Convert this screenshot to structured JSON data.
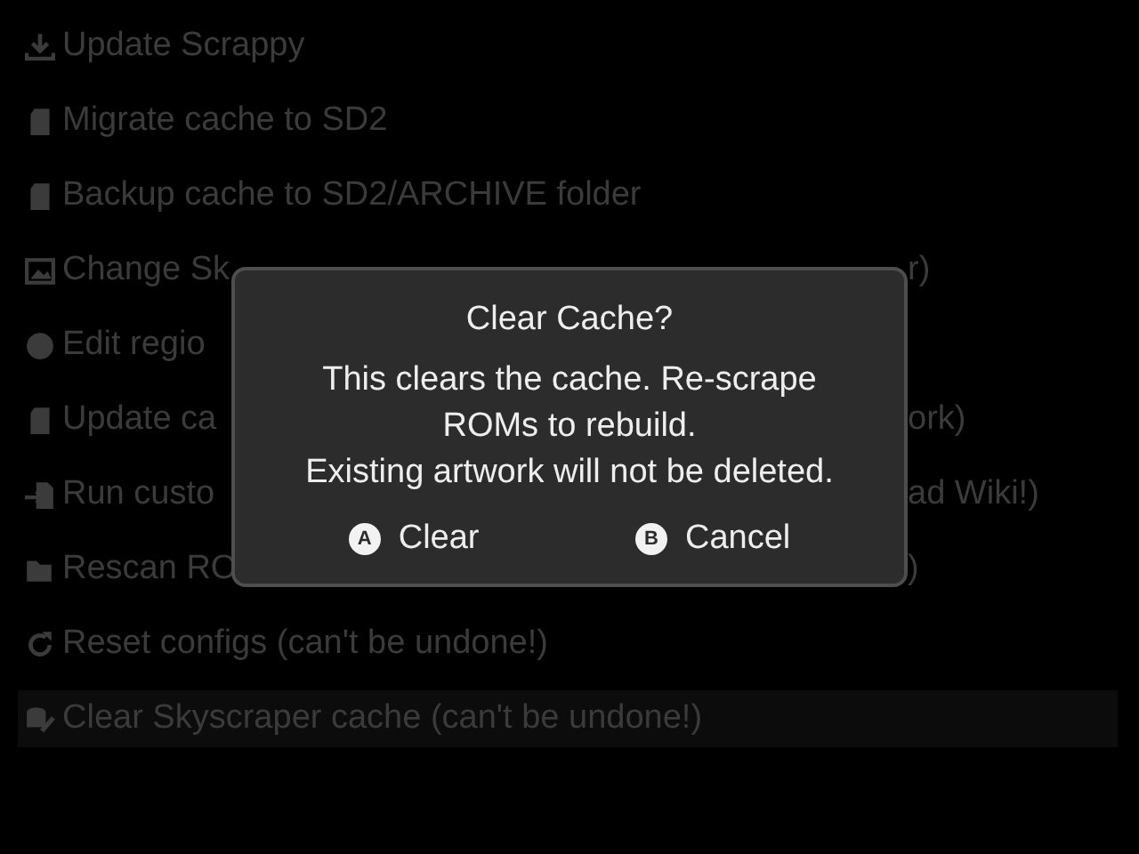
{
  "menu": [
    {
      "text": "Update Scrappy",
      "selected": false
    },
    {
      "text": "Migrate cache to SD2",
      "selected": false
    },
    {
      "text": "Backup cache to SD2/ARCHIVE folder",
      "selected": false
    },
    {
      "text": "Change Sk",
      "text_right": "r)",
      "selected": false
    },
    {
      "text": "Edit regio",
      "selected": false
    },
    {
      "text": "Update ca",
      "text_right": "ork)",
      "selected": false
    },
    {
      "text": "Run custo",
      "text_right": "ad Wiki!)",
      "selected": false
    },
    {
      "text": "Rescan RO",
      "text_right": ")",
      "selected": false
    },
    {
      "text": "Reset configs (can't be undone!)",
      "selected": false
    },
    {
      "text": "Clear Skyscraper cache (can't be undone!)",
      "selected": true
    }
  ],
  "dialog": {
    "title": "Clear Cache?",
    "lines": [
      "This clears the cache. Re-scrape",
      "ROMs to rebuild.",
      "Existing artwork will not be deleted."
    ],
    "buttons": [
      {
        "key": "A",
        "label": "Clear"
      },
      {
        "key": "B",
        "label": "Cancel"
      }
    ]
  }
}
